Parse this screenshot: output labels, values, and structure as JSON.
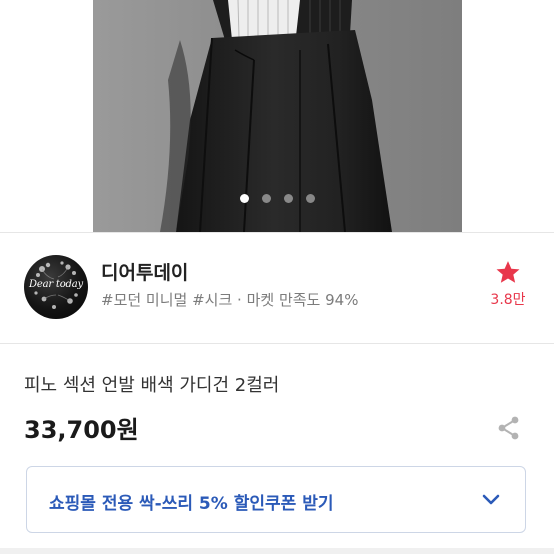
{
  "gallery": {
    "image_name": "product-photo",
    "slide_count": 4,
    "active_slide": 1
  },
  "shop": {
    "logo_text": "Dear today",
    "name": "디어투데이",
    "tags": "#모던 미니멀 #시크 · 마켓 만족도 94%",
    "favorite_count": "3.8만",
    "favorite_icon": "star-icon"
  },
  "product": {
    "title": "피노 섹션 언발 배색 가디건 2컬러",
    "price": "33,700원",
    "share_icon": "share-icon"
  },
  "coupon": {
    "label": "쇼핑몰 전용 싹-쓰리 5% 할인쿠폰 받기",
    "expand_icon": "chevron-down-icon"
  },
  "colors": {
    "accent_red": "#e8374b",
    "coupon_blue": "#2b5ab8"
  }
}
